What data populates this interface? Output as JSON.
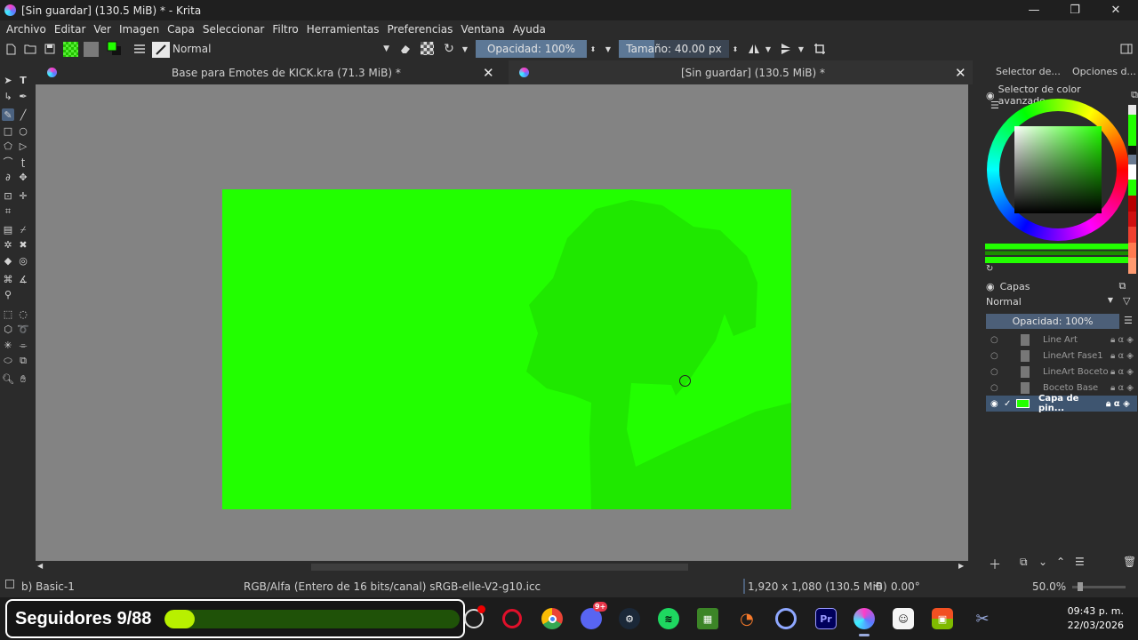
{
  "window": {
    "title": "[Sin guardar]  (130.5 MiB) * - Krita",
    "minimize": "—",
    "restore": "❐",
    "close": "✕"
  },
  "menu": [
    "Archivo",
    "Editar",
    "Ver",
    "Imagen",
    "Capa",
    "Seleccionar",
    "Filtro",
    "Herramientas",
    "Preferencias",
    "Ventana",
    "Ayuda"
  ],
  "toolbar": {
    "blend_mode": "Normal",
    "opacity_label": "Opacidad: 100%",
    "opacity_fraction": 1.0,
    "size_label": "Tamaño: 40.00 px",
    "size_fraction": 0.32
  },
  "tabs": [
    {
      "label": "Base para Emotes de KICK.kra (71.3 MiB) *",
      "close": "✕"
    },
    {
      "label": "[Sin guardar]  (130.5 MiB) *",
      "close": "✕"
    }
  ],
  "dock": {
    "tab1": "Selector de...",
    "tab2": "Opciones d...",
    "color_selector_title": "Selector de color avanzado",
    "layers_title": "Capas",
    "layers_blend": "Normal",
    "layers_opacity": "Opacidad:  100%",
    "layers": [
      {
        "name": "Line Art",
        "visible": false,
        "selected": false
      },
      {
        "name": "LineArt Fase1",
        "visible": false,
        "selected": false
      },
      {
        "name": "LineArt Boceto",
        "visible": false,
        "selected": false
      },
      {
        "name": "Boceto Base",
        "visible": false,
        "selected": false
      },
      {
        "name": "Capa de pin...",
        "visible": true,
        "selected": true
      }
    ]
  },
  "colors": {
    "canvas_fill": "#22ff00",
    "shape_fill": "#1fe800",
    "accent": "#4b6280"
  },
  "status": {
    "brush": "b) Basic-1",
    "color_space": "RGB/Alfa (Entero de 16 bits/canal)  sRGB-elle-V2-g10.icc",
    "dimensions": "1,920 x 1,080 (130.5 MiB)",
    "rotation": "0.00°",
    "zoom": "50.0%"
  },
  "taskbar": {
    "followers_label": "Seguidores 9/88",
    "followers_current": 9,
    "followers_goal": 88,
    "discord_badge": "9+",
    "premiere_label": "Pr",
    "time": "09:43 p. m.",
    "date": "22/03/2026"
  }
}
